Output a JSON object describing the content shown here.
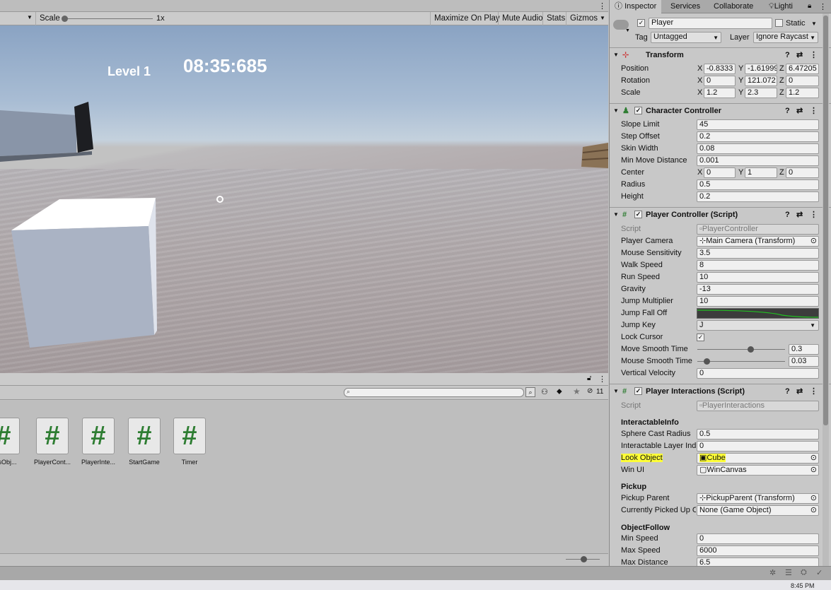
{
  "game": {
    "toolbar": {
      "scale_label": "Scale",
      "scale_value": "1x",
      "maximize": "Maximize On Play",
      "mute": "Mute Audio",
      "stats": "Stats",
      "gizmos": "Gizmos"
    },
    "hud": {
      "level": "Level 1",
      "timer": "08:35:685"
    }
  },
  "project": {
    "search_count": "11",
    "assets": [
      {
        "name": "sicsObj...",
        "icon": "#"
      },
      {
        "name": "PlayerCont...",
        "icon": "#"
      },
      {
        "name": "PlayerInte...",
        "icon": "#"
      },
      {
        "name": "StartGame",
        "icon": "#"
      },
      {
        "name": "Timer",
        "icon": "#"
      }
    ]
  },
  "inspector": {
    "tabs": [
      "Inspector",
      "Services",
      "Collaborate",
      "Lighti"
    ],
    "object_name": "Player",
    "static_label": "Static",
    "tag_label": "Tag",
    "tag_value": "Untagged",
    "layer_label": "Layer",
    "layer_value": "Ignore Raycast",
    "transform": {
      "title": "Transform",
      "position": {
        "label": "Position",
        "x": "-0.8333",
        "y": "-1.61999",
        "z": "6.47205"
      },
      "rotation": {
        "label": "Rotation",
        "x": "0",
        "y": "121.072",
        "z": "0"
      },
      "scale": {
        "label": "Scale",
        "x": "1.2",
        "y": "2.3",
        "z": "1.2"
      }
    },
    "character_controller": {
      "title": "Character Controller",
      "slope_limit": {
        "label": "Slope Limit",
        "value": "45"
      },
      "step_offset": {
        "label": "Step Offset",
        "value": "0.2"
      },
      "skin_width": {
        "label": "Skin Width",
        "value": "0.08"
      },
      "min_move": {
        "label": "Min Move Distance",
        "value": "0.001"
      },
      "center": {
        "label": "Center",
        "x": "0",
        "y": "1",
        "z": "0"
      },
      "radius": {
        "label": "Radius",
        "value": "0.5"
      },
      "height": {
        "label": "Height",
        "value": "0.2"
      }
    },
    "player_controller": {
      "title": "Player Controller (Script)",
      "script": {
        "label": "Script",
        "value": "PlayerController"
      },
      "player_camera": {
        "label": "Player Camera",
        "value": "Main Camera (Transform)"
      },
      "mouse_sensitivity": {
        "label": "Mouse Sensitivity",
        "value": "3.5"
      },
      "walk_speed": {
        "label": "Walk Speed",
        "value": "8"
      },
      "run_speed": {
        "label": "Run Speed",
        "value": "10"
      },
      "gravity": {
        "label": "Gravity",
        "value": "-13"
      },
      "jump_multiplier": {
        "label": "Jump Multiplier",
        "value": "10"
      },
      "jump_fall_off": {
        "label": "Jump Fall Off"
      },
      "jump_key": {
        "label": "Jump Key",
        "value": "J"
      },
      "lock_cursor": {
        "label": "Lock Cursor",
        "checked": true
      },
      "move_smooth": {
        "label": "Move Smooth Time",
        "value": "0.3",
        "fraction": 0.6
      },
      "mouse_smooth": {
        "label": "Mouse Smooth Time",
        "value": "0.03",
        "fraction": 0.08
      },
      "vertical_velocity": {
        "label": "Vertical Velocity",
        "value": "0"
      }
    },
    "player_interactions": {
      "title": "Player Interactions (Script)",
      "script": {
        "label": "Script",
        "value": "PlayerInteractions"
      },
      "interactable_info": "InteractableInfo",
      "sphere_cast_radius": {
        "label": "Sphere Cast Radius",
        "value": "0.5"
      },
      "interactable_layer": {
        "label": "Interactable Layer Ind",
        "value": "0"
      },
      "look_object": {
        "label": "Look Object",
        "value": "Cube"
      },
      "win_ui": {
        "label": "Win UI",
        "value": "WinCanvas"
      },
      "pickup": "Pickup",
      "pickup_parent": {
        "label": "Pickup Parent",
        "value": "PickupParent (Transform)"
      },
      "currently_picked": {
        "label": "Currently Picked Up C",
        "value": "None (Game Object)"
      },
      "object_follow": "ObjectFollow",
      "min_speed": {
        "label": "Min Speed",
        "value": "0"
      },
      "max_speed": {
        "label": "Max Speed",
        "value": "6000"
      },
      "max_distance": {
        "label": "Max Distance",
        "value": "6.5"
      }
    }
  },
  "taskbar": {
    "clock": "8:45 PM"
  },
  "colors": {
    "highlight": "#ffff37",
    "script_green": "#2e7d32",
    "curve_green": "#22c022"
  }
}
